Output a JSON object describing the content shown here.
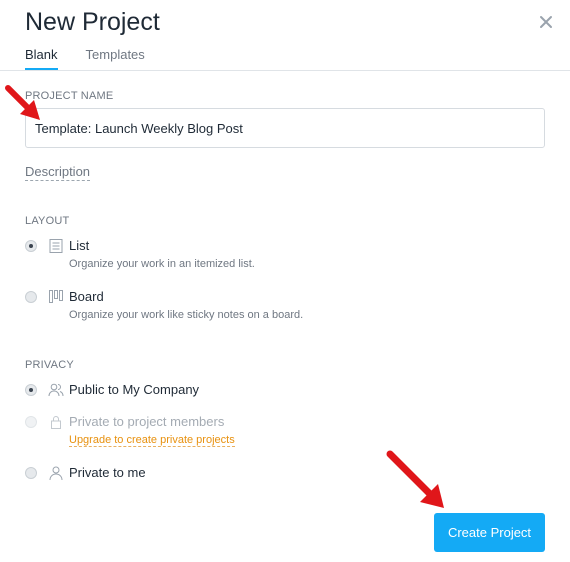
{
  "dialog": {
    "title": "New Project",
    "tabs": [
      {
        "label": "Blank",
        "active": true
      },
      {
        "label": "Templates",
        "active": false
      }
    ]
  },
  "project_name": {
    "label": "PROJECT NAME",
    "value": "Template: Launch Weekly Blog Post"
  },
  "description": {
    "label": "Description"
  },
  "layout": {
    "label": "LAYOUT",
    "options": [
      {
        "label": "List",
        "description": "Organize your work in an itemized list.",
        "selected": true,
        "icon": "list-icon"
      },
      {
        "label": "Board",
        "description": "Organize your work like sticky notes on a board.",
        "selected": false,
        "icon": "board-icon"
      }
    ]
  },
  "privacy": {
    "label": "PRIVACY",
    "options": [
      {
        "label": "Public to My Company",
        "selected": true,
        "disabled": false,
        "icon": "people-icon"
      },
      {
        "label": "Private to project members",
        "selected": false,
        "disabled": true,
        "icon": "lock-icon",
        "upgrade_link": "Upgrade to create private projects"
      },
      {
        "label": "Private to me",
        "selected": false,
        "disabled": false,
        "icon": "person-icon"
      }
    ]
  },
  "actions": {
    "create_label": "Create Project"
  },
  "colors": {
    "accent": "#14aaf5",
    "upgrade": "#e8910f",
    "annotation_arrow": "#e0161a"
  }
}
